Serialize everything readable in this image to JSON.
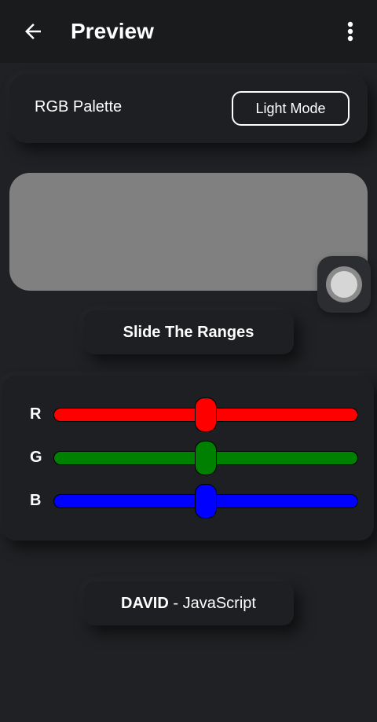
{
  "appbar": {
    "title": "Preview",
    "back_icon": "arrow-left-icon",
    "menu_icon": "more-vertical-icon"
  },
  "header": {
    "label": "RGB Palette",
    "mode_button": "Light Mode"
  },
  "preview": {
    "color": "#808080"
  },
  "fab": {
    "icon": "circle-toggle-icon"
  },
  "instruction": "Slide The Ranges",
  "sliders": [
    {
      "label": "R",
      "color": "#ff0000",
      "value": 128,
      "max": 255
    },
    {
      "label": "G",
      "color": "#008000",
      "value": 128,
      "max": 255
    },
    {
      "label": "B",
      "color": "#0000ff",
      "value": 128,
      "max": 255
    }
  ],
  "footer": {
    "author": "DAVID",
    "separator": " - ",
    "language": "JavaScript"
  },
  "colors": {
    "background": "#202124",
    "appbar": "#1a1b1d",
    "card": "#1e1f22"
  }
}
